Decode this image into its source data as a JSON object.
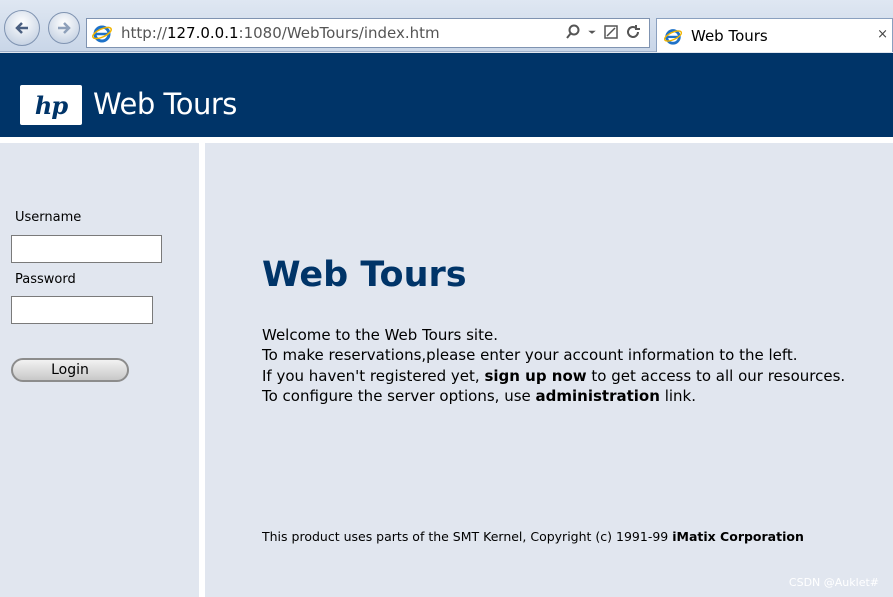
{
  "browser": {
    "url_prefix": "http://",
    "url_host": "127.0.0.1",
    "url_rest": ":1080/WebTours/index.htm",
    "tab_title": "Web Tours",
    "tab_close": "×"
  },
  "header": {
    "logo_text": "hp",
    "site_title": "Web Tours"
  },
  "login": {
    "username_label": "Username",
    "password_label": "Password",
    "username_value": "",
    "password_value": "",
    "login_button": "Login"
  },
  "main": {
    "title": "Web Tours",
    "line1": "Welcome to the Web Tours site.",
    "line2": "To make reservations,please enter your account information to the left.",
    "line3_pre": "If you haven't registered yet, ",
    "line3_link": "sign up now",
    "line3_post": " to get access to all our resources.",
    "line4_pre": "To configure the server options, use ",
    "line4_link": "administration",
    "line4_post": " link.",
    "footer_pre": "This product uses parts of the SMT Kernel, Copyright (c) 1991-99 ",
    "footer_link": "iMatix Corporation"
  },
  "watermark": "CSDN @Auklet#",
  "colors": {
    "header_bg": "#003468",
    "panel_bg": "#e1e6ef",
    "title_color": "#003468"
  }
}
